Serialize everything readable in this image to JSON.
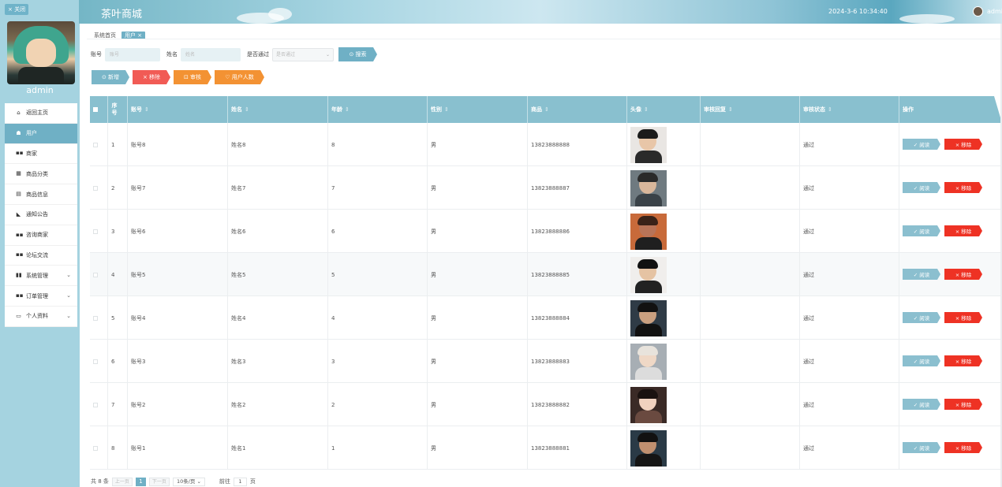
{
  "sidebar": {
    "close_label": "× 关闭",
    "profile_name": "admin",
    "items": [
      {
        "label": "返回主页",
        "icon": "home-icon",
        "glyph": "⌂",
        "active": false
      },
      {
        "label": "用户",
        "icon": "user-icon",
        "glyph": "☗",
        "active": true
      },
      {
        "label": "商家",
        "icon": "grid-icon",
        "glyph": "▪▪",
        "active": false
      },
      {
        "label": "商品分类",
        "icon": "grid-icon",
        "glyph": "▦",
        "active": false
      },
      {
        "label": "商品信息",
        "icon": "doc-icon",
        "glyph": "▤",
        "active": false
      },
      {
        "label": "通知公告",
        "icon": "notice-icon",
        "glyph": "◣",
        "active": false
      },
      {
        "label": "咨询商家",
        "icon": "grid-icon",
        "glyph": "▪▪",
        "active": false
      },
      {
        "label": "论坛交流",
        "icon": "grid-icon",
        "glyph": "▪▪",
        "active": false
      },
      {
        "label": "系统管理",
        "icon": "chart-icon",
        "glyph": "▮▮",
        "active": false,
        "expand": true
      },
      {
        "label": "订单管理",
        "icon": "grid-icon",
        "glyph": "▪▪",
        "active": false,
        "expand": true
      },
      {
        "label": "个人资料",
        "icon": "card-icon",
        "glyph": "▭",
        "active": false,
        "expand": true
      }
    ]
  },
  "header": {
    "title": "茶叶商城",
    "datetime": "2024-3-6 10:34:40",
    "username": "admin"
  },
  "breadcrumb": {
    "home": "系统首页",
    "current": "用户 ×"
  },
  "search": {
    "account_label": "账号",
    "account_placeholder": "账号",
    "name_label": "姓名",
    "name_placeholder": "姓名",
    "passed_label": "是否通过",
    "passed_placeholder": "是否通过",
    "search_button": "⊙ 搜索"
  },
  "actions": {
    "add": "⊙ 新增",
    "remove": "× 移除",
    "review": "⊡ 审核",
    "user_count": "♡ 用户人数"
  },
  "table": {
    "headers": [
      "序号",
      "账号",
      "姓名",
      "年龄",
      "性别",
      "商品",
      "头像",
      "审核回复",
      "审核状态",
      "操作"
    ],
    "sort_glyph": "⇕",
    "rows": [
      {
        "index": "1",
        "account": "账号8",
        "name": "姓名8",
        "age": "8",
        "gender": "男",
        "phone": "13823888888",
        "reply": "",
        "status": "通过"
      },
      {
        "index": "2",
        "account": "账号7",
        "name": "姓名7",
        "age": "7",
        "gender": "男",
        "phone": "13823888887",
        "reply": "",
        "status": "通过"
      },
      {
        "index": "3",
        "account": "账号6",
        "name": "姓名6",
        "age": "6",
        "gender": "男",
        "phone": "13823888886",
        "reply": "",
        "status": "通过"
      },
      {
        "index": "4",
        "account": "账号5",
        "name": "姓名5",
        "age": "5",
        "gender": "男",
        "phone": "13823888885",
        "reply": "",
        "status": "通过"
      },
      {
        "index": "5",
        "account": "账号4",
        "name": "姓名4",
        "age": "4",
        "gender": "男",
        "phone": "13823888884",
        "reply": "",
        "status": "通过"
      },
      {
        "index": "6",
        "account": "账号3",
        "name": "姓名3",
        "age": "3",
        "gender": "男",
        "phone": "13823888883",
        "reply": "",
        "status": "通过"
      },
      {
        "index": "7",
        "account": "账号2",
        "name": "姓名2",
        "age": "2",
        "gender": "男",
        "phone": "13823888882",
        "reply": "",
        "status": "通过"
      },
      {
        "index": "8",
        "account": "账号1",
        "name": "姓名1",
        "age": "1",
        "gender": "男",
        "phone": "13823888881",
        "reply": "",
        "status": "通过"
      }
    ],
    "read_label": "✓ 阅读",
    "delete_label": "× 移除"
  },
  "pager": {
    "total": "共 8 条",
    "prev": "上一页",
    "current": "1",
    "next": "下一页",
    "page_size": "10条/页 ⌄",
    "goto_label": "前往",
    "goto_value": "1",
    "page_suffix": "页"
  },
  "colors": {
    "accent": "#6fb0c5",
    "danger": "#ee3224",
    "warning": "#f39233"
  }
}
